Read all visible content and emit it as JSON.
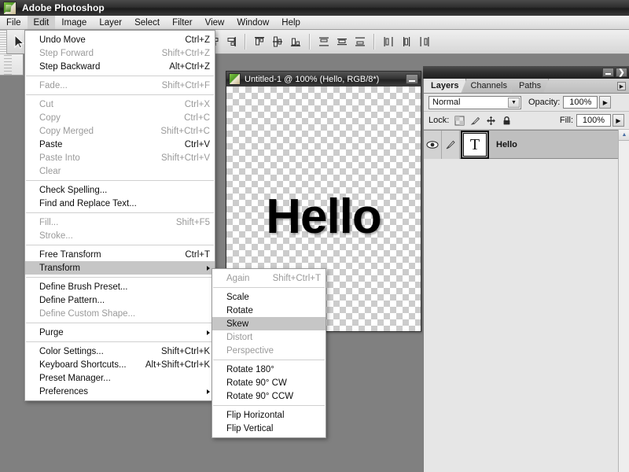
{
  "app": {
    "title": "Adobe Photoshop",
    "logo_icon": "photoshop-logo-icon"
  },
  "menubar": {
    "items": [
      {
        "label": "File",
        "active": false
      },
      {
        "label": "Edit",
        "active": true
      },
      {
        "label": "Image",
        "active": false
      },
      {
        "label": "Layer",
        "active": false
      },
      {
        "label": "Select",
        "active": false
      },
      {
        "label": "Filter",
        "active": false
      },
      {
        "label": "View",
        "active": false
      },
      {
        "label": "Window",
        "active": false
      },
      {
        "label": "Help",
        "active": false
      }
    ]
  },
  "options_bar": {
    "tool_icon": "move-tool-cursor-icon",
    "align_icons": [
      "align-left-edges-icon",
      "align-horizontal-centers-icon",
      "align-right-edges-icon",
      "align-top-edges-icon",
      "align-vertical-centers-icon",
      "align-bottom-edges-icon",
      "distribute-top-edges-icon",
      "distribute-vertical-centers-icon",
      "distribute-bottom-edges-icon",
      "distribute-left-edges-icon",
      "distribute-horizontal-centers-icon",
      "distribute-right-edges-icon"
    ]
  },
  "edit_menu": {
    "items": [
      {
        "label": "Undo Move",
        "accel": "Ctrl+Z",
        "disabled": false,
        "submenu": false
      },
      {
        "label": "Step Forward",
        "accel": "Shift+Ctrl+Z",
        "disabled": true,
        "submenu": false
      },
      {
        "label": "Step Backward",
        "accel": "Alt+Ctrl+Z",
        "disabled": false,
        "submenu": false
      },
      {
        "separator": true
      },
      {
        "label": "Fade...",
        "accel": "Shift+Ctrl+F",
        "disabled": true,
        "submenu": false
      },
      {
        "separator": true
      },
      {
        "label": "Cut",
        "accel": "Ctrl+X",
        "disabled": true,
        "submenu": false
      },
      {
        "label": "Copy",
        "accel": "Ctrl+C",
        "disabled": true,
        "submenu": false
      },
      {
        "label": "Copy Merged",
        "accel": "Shift+Ctrl+C",
        "disabled": true,
        "submenu": false
      },
      {
        "label": "Paste",
        "accel": "Ctrl+V",
        "disabled": false,
        "submenu": false
      },
      {
        "label": "Paste Into",
        "accel": "Shift+Ctrl+V",
        "disabled": true,
        "submenu": false
      },
      {
        "label": "Clear",
        "accel": "",
        "disabled": true,
        "submenu": false
      },
      {
        "separator": true
      },
      {
        "label": "Check Spelling...",
        "accel": "",
        "disabled": false,
        "submenu": false
      },
      {
        "label": "Find and Replace Text...",
        "accel": "",
        "disabled": false,
        "submenu": false
      },
      {
        "separator": true
      },
      {
        "label": "Fill...",
        "accel": "Shift+F5",
        "disabled": true,
        "submenu": false
      },
      {
        "label": "Stroke...",
        "accel": "",
        "disabled": true,
        "submenu": false
      },
      {
        "separator": true
      },
      {
        "label": "Free Transform",
        "accel": "Ctrl+T",
        "disabled": false,
        "submenu": false
      },
      {
        "label": "Transform",
        "accel": "",
        "disabled": false,
        "submenu": true,
        "highlight": true
      },
      {
        "separator": true
      },
      {
        "label": "Define Brush Preset...",
        "accel": "",
        "disabled": false,
        "submenu": false
      },
      {
        "label": "Define Pattern...",
        "accel": "",
        "disabled": false,
        "submenu": false
      },
      {
        "label": "Define Custom Shape...",
        "accel": "",
        "disabled": true,
        "submenu": false
      },
      {
        "separator": true
      },
      {
        "label": "Purge",
        "accel": "",
        "disabled": false,
        "submenu": true
      },
      {
        "separator": true
      },
      {
        "label": "Color Settings...",
        "accel": "Shift+Ctrl+K",
        "disabled": false,
        "submenu": false
      },
      {
        "label": "Keyboard Shortcuts...",
        "accel": "Alt+Shift+Ctrl+K",
        "disabled": false,
        "submenu": false
      },
      {
        "label": "Preset Manager...",
        "accel": "",
        "disabled": false,
        "submenu": false
      },
      {
        "label": "Preferences",
        "accel": "",
        "disabled": false,
        "submenu": true
      }
    ]
  },
  "transform_menu": {
    "items": [
      {
        "label": "Again",
        "accel": "Shift+Ctrl+T",
        "disabled": true
      },
      {
        "separator": true
      },
      {
        "label": "Scale",
        "accel": "",
        "disabled": false
      },
      {
        "label": "Rotate",
        "accel": "",
        "disabled": false
      },
      {
        "label": "Skew",
        "accel": "",
        "disabled": false,
        "highlight": true
      },
      {
        "label": "Distort",
        "accel": "",
        "disabled": true
      },
      {
        "label": "Perspective",
        "accel": "",
        "disabled": true
      },
      {
        "separator": true
      },
      {
        "label": "Rotate 180°",
        "accel": "",
        "disabled": false
      },
      {
        "label": "Rotate 90° CW",
        "accel": "",
        "disabled": false
      },
      {
        "label": "Rotate 90° CCW",
        "accel": "",
        "disabled": false
      },
      {
        "separator": true
      },
      {
        "label": "Flip Horizontal",
        "accel": "",
        "disabled": false
      },
      {
        "label": "Flip Vertical",
        "accel": "",
        "disabled": false
      }
    ]
  },
  "document": {
    "title": "Untitled-1 @ 100% (Hello, RGB/8*)",
    "canvas_text": "Hello",
    "minimize_icon": "minimize-icon"
  },
  "layers_panel": {
    "dock_minimize_icon": "minimize-icon",
    "dock_close_icon": "close-icon",
    "tabs": [
      {
        "label": "Layers",
        "active": true
      },
      {
        "label": "Channels",
        "active": false
      },
      {
        "label": "Paths",
        "active": false
      }
    ],
    "menu_arrow_icon": "panel-menu-arrow-icon",
    "blend_mode": "Normal",
    "blend_dropdown_icon": "chevron-down-icon",
    "opacity_label": "Opacity:",
    "opacity_value": "100%",
    "opacity_spinner_icon": "chevron-right-icon",
    "lock_label": "Lock:",
    "lock_icons": [
      "lock-transparent-pixels-icon",
      "lock-image-pixels-icon",
      "lock-position-icon",
      "lock-all-icon"
    ],
    "fill_label": "Fill:",
    "fill_value": "100%",
    "fill_spinner_icon": "chevron-right-icon",
    "layers": [
      {
        "name": "Hello",
        "visible_icon": "eye-icon",
        "link_icon": "brush-icon",
        "thumbnail_glyph": "T",
        "selected": true
      }
    ],
    "scroll_up_icon": "scroll-up-arrow-icon"
  },
  "colors": {
    "workspace_bg": "#808080",
    "panel_bg": "#e6e6e6",
    "menu_bg": "#ffffff",
    "menu_highlight": "#c6c6c6",
    "disabled_text": "#9a9a9a",
    "titlebar_dark": "#2f2f2f",
    "layer_selected": "#bfbfbf"
  }
}
